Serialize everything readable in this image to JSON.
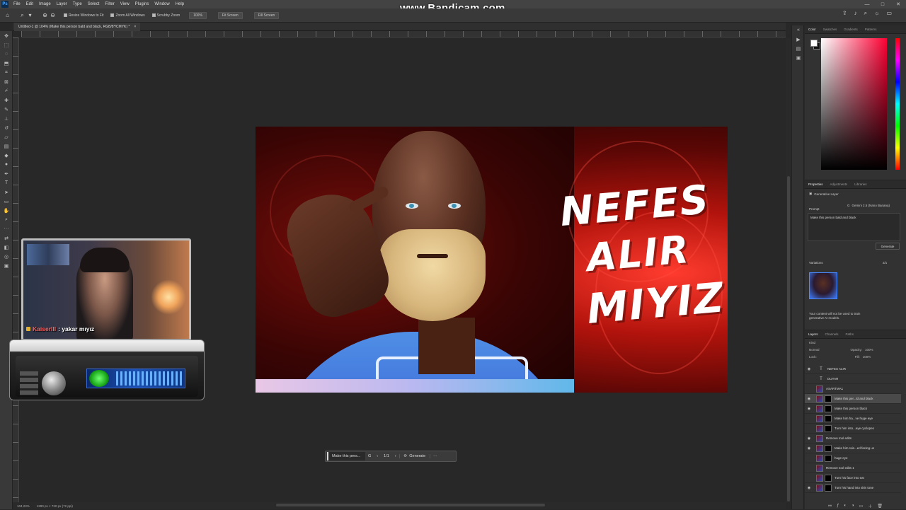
{
  "app": {
    "menu": [
      "File",
      "Edit",
      "Image",
      "Layer",
      "Type",
      "Select",
      "Filter",
      "View",
      "Plugins",
      "Window",
      "Help"
    ],
    "window_controls": [
      "—",
      "□",
      "✕"
    ]
  },
  "watermark": "www.Bandicam.com",
  "options_bar": {
    "resize_windows_label": "Resize Windows to Fit",
    "zoom_all_windows_label": "Zoom All Windows",
    "scrubby_zoom_label": "Scrubby Zoom",
    "zoom_value": "100%",
    "fit_screen_label": "Fit Screen",
    "fill_screen_label": "Fill Screen"
  },
  "document": {
    "tab_title": "Untitled-1 @ 104% (Make this person bald and black, RGB/8*/CMYK) *",
    "status_zoom": "104,23%",
    "status_size": "1280 px × 720 px (72 ppi)"
  },
  "artwork": {
    "line1": "NEFES",
    "line2": "ALIR",
    "line3": "MIYIZ?"
  },
  "context_bar": {
    "prompt_preview": "Make this pers...",
    "page_indicator": "1/1",
    "generate_label": "Generate",
    "more_label": "···"
  },
  "webcam": {
    "chat_user": "KaiserIII",
    "chat_text": ": yakar mıyız"
  },
  "color_panel": {
    "tabs": [
      "Color",
      "Swatches",
      "Gradients",
      "Patterns"
    ],
    "foreground": "#ffffff",
    "background": "#111111"
  },
  "properties_panel": {
    "tabs": [
      "Properties",
      "Adjustments",
      "Libraries"
    ],
    "layer_type": "Generative Layer",
    "prompt_label": "Prompt",
    "model": "Gemini 2.5 (Nano Banana)",
    "prompt_text": "Make this person bald and black",
    "generate_label": "Generate",
    "variations_label": "Variations",
    "variations_count": "2/1",
    "notice": "Your content will not be used to train generative AI models."
  },
  "layers_panel": {
    "tabs": [
      "Layers",
      "Channels",
      "Paths"
    ],
    "filter_kind": "Kind",
    "blend_mode": "Normal",
    "opacity_label": "Opacity:",
    "opacity_value": "100%",
    "lock_label": "Lock:",
    "fill_label": "Fill:",
    "fill_value": "100%",
    "layers": [
      {
        "name": "NEFES ALIR",
        "kind": "text",
        "visible": true
      },
      {
        "name": "DUYAR",
        "kind": "text",
        "visible": false
      },
      {
        "name": "ASARTMA1",
        "kind": "image",
        "visible": false
      },
      {
        "name": "Make this per...ld and black",
        "kind": "gen",
        "visible": true,
        "selected": true
      },
      {
        "name": "Make this person black",
        "kind": "gen",
        "visible": true
      },
      {
        "name": "Make him ha...ve huge eye",
        "kind": "gen",
        "visible": false
      },
      {
        "name": "Turn him into...eye cyclopes",
        "kind": "gen",
        "visible": false
      },
      {
        "name": "Remove tool edits",
        "kind": "image",
        "visible": true
      },
      {
        "name": "Make him rais...ed facing us",
        "kind": "gen",
        "visible": true
      },
      {
        "name": "huge eye",
        "kind": "gen",
        "visible": false
      },
      {
        "name": "Remove tool edits 1",
        "kind": "image",
        "visible": false
      },
      {
        "name": "Turn his face into ear",
        "kind": "gen",
        "visible": false
      },
      {
        "name": "Turn his hand into skin tone",
        "kind": "gen",
        "visible": true
      }
    ]
  }
}
